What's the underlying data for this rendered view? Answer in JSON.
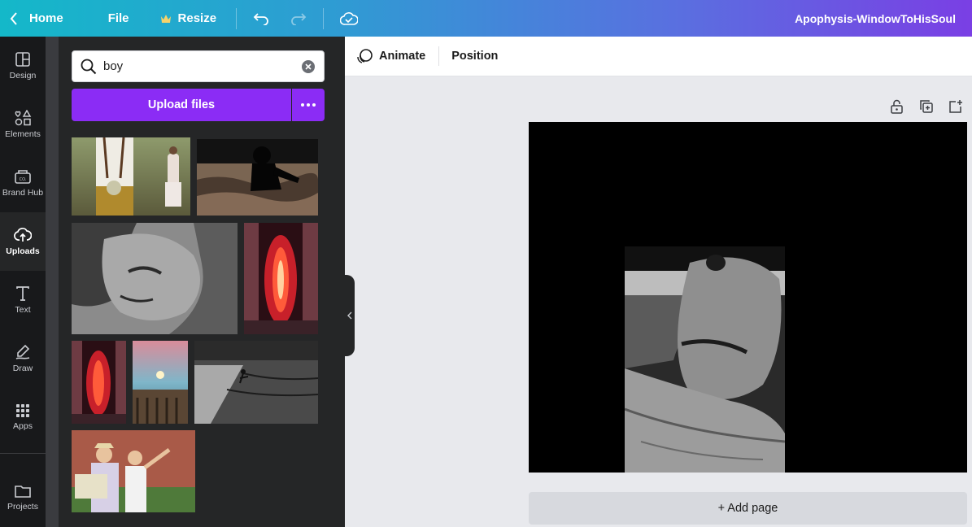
{
  "topbar": {
    "home_label": "Home",
    "file_label": "File",
    "resize_label": "Resize",
    "design_title": "Apophysis-WindowToHisSoul"
  },
  "rail": {
    "items": [
      {
        "label": "Design",
        "icon": "layout-icon"
      },
      {
        "label": "Elements",
        "icon": "shapes-icon"
      },
      {
        "label": "Brand Hub",
        "icon": "brand-icon"
      },
      {
        "label": "Uploads",
        "icon": "cloud-upload-icon"
      },
      {
        "label": "Text",
        "icon": "text-icon"
      },
      {
        "label": "Draw",
        "icon": "pen-icon"
      },
      {
        "label": "Apps",
        "icon": "grid-icon"
      },
      {
        "label": "Projects",
        "icon": "folder-icon"
      }
    ],
    "active": "Uploads"
  },
  "uploads": {
    "search_value": "boy",
    "upload_label": "Upload files"
  },
  "toolbar": {
    "animate_label": "Animate",
    "position_label": "Position"
  },
  "editor": {
    "add_page_label": "+ Add page"
  },
  "colors": {
    "accent": "#8b2cf5",
    "rail_bg": "#18191b",
    "panel_bg": "#252627"
  }
}
